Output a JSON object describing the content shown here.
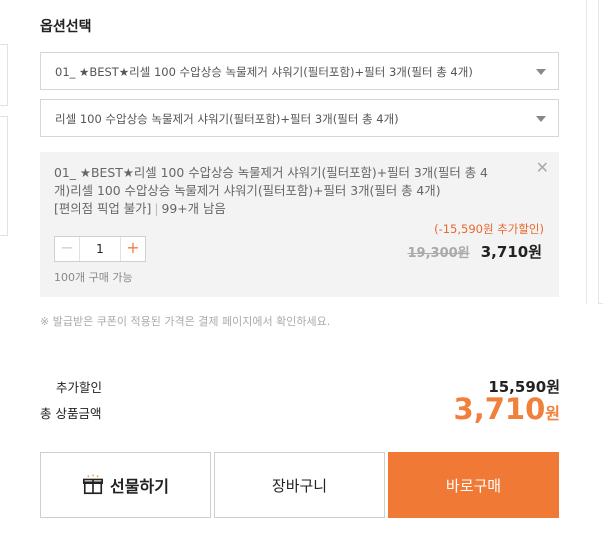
{
  "section_title": "옵션선택",
  "selects": [
    {
      "value": "01_ ★BEST★리셀 100 수압상승 녹물제거 샤워기(필터포함)+필터 3개(필터 총 4개)"
    },
    {
      "value": "리셀 100 수압상승 녹물제거 샤워기(필터포함)+필터 3개(필터 총 4개)"
    }
  ],
  "selected_option": {
    "name": "01_ ★BEST★리셀 100 수압상승 녹물제거 샤워기(필터포함)+필터 3개(필터 총 4개)리셀 100 수압상승 녹물제거 샤워기(필터포함)+필터 3개(필터 총 4개)",
    "delivery_note": "[편의점 픽업 불가]",
    "stock": "99+개 남음",
    "quantity": "1",
    "minus": "−",
    "plus": "+",
    "limit": "100개 구매 가능",
    "discount": "(-15,590원 추가할인)",
    "original_price": "19,300원",
    "price": "3,710원",
    "close": "✕"
  },
  "notice": "※ 발급받은 쿠폰이 적용된 가격은 결제 페이지에서 확인하세요.",
  "summary": {
    "extra_discount_label": "추가할인",
    "extra_discount_value": "15,590원",
    "total_label": "총 상품금액",
    "total_value": "3,710",
    "total_unit": "원"
  },
  "actions": {
    "gift": "선물하기",
    "cart": "장바구니",
    "buy": "바로구매"
  },
  "colors": {
    "accent": "#f07a35",
    "discount_text": "#e8692f"
  }
}
